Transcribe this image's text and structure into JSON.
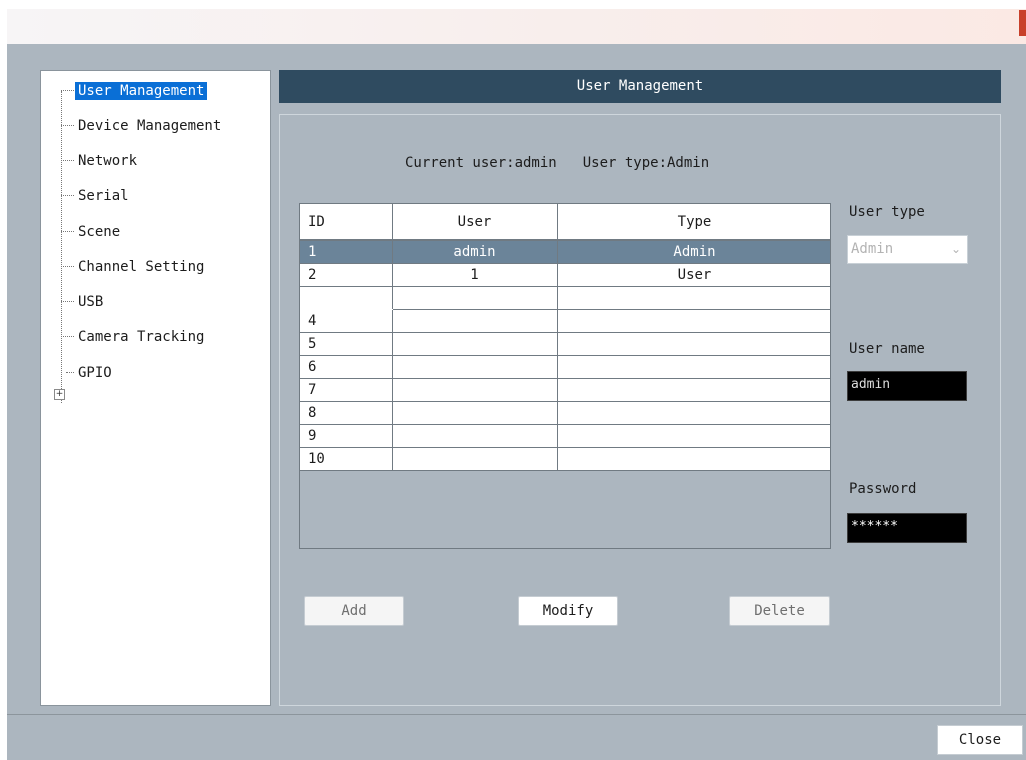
{
  "nav": {
    "items": [
      {
        "label": "User Management",
        "selected": true
      },
      {
        "label": "Device Management"
      },
      {
        "label": "Network"
      },
      {
        "label": "Serial"
      },
      {
        "label": "Scene"
      },
      {
        "label": "Channel Setting"
      },
      {
        "label": "USB"
      },
      {
        "label": "Camera Tracking"
      },
      {
        "label": "GPIO",
        "expandable": true
      }
    ]
  },
  "panel": {
    "title": "User Management",
    "current_user": "Current user:admin",
    "user_type_status": "User type:Admin"
  },
  "table": {
    "headers": [
      "ID",
      "User",
      "Type"
    ],
    "rows": [
      {
        "id": "1",
        "user": "admin",
        "type": "Admin",
        "selected": true
      },
      {
        "id": "2",
        "user": "1",
        "type": "User"
      },
      {
        "id": "",
        "user": "",
        "type": ""
      },
      {
        "id": "4",
        "user": "",
        "type": ""
      },
      {
        "id": "5",
        "user": "",
        "type": ""
      },
      {
        "id": "6",
        "user": "",
        "type": ""
      },
      {
        "id": "7",
        "user": "",
        "type": ""
      },
      {
        "id": "8",
        "user": "",
        "type": ""
      },
      {
        "id": "9",
        "user": "",
        "type": ""
      },
      {
        "id": "10",
        "user": "",
        "type": ""
      }
    ]
  },
  "form": {
    "user_type_label": "User type",
    "user_type_value": "Admin",
    "user_name_label": "User name",
    "user_name_value": "admin",
    "password_label": "Password",
    "password_value": "******"
  },
  "buttons": {
    "add": "Add",
    "modify": "Modify",
    "delete": "Delete",
    "close": "Close"
  },
  "colors": {
    "header_bg": "#2f4b60",
    "window_bg": "#acb6bf",
    "selection_blue": "#0a6fd6",
    "row_selected": "#6b8499"
  },
  "icons": {
    "titlebar_close": "close-icon",
    "tree_expand": "plus-icon",
    "select_chevron": "chevron-down-icon"
  }
}
